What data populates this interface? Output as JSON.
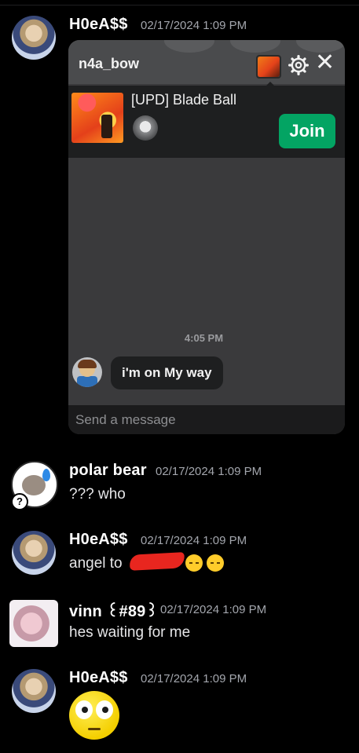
{
  "messages": [
    {
      "username": "H0eA$$",
      "timestamp": "02/17/2024 1:09 PM",
      "embed": {
        "chat_title": "n4a_bow",
        "game_title": "[UPD] Blade Ball",
        "join_label": "Join",
        "chat_time": "4:05 PM",
        "chat_message": "i'm on My way",
        "send_placeholder": "Send a message"
      }
    },
    {
      "username": "polar bear",
      "timestamp": "02/17/2024 1:09 PM",
      "text": "??? who",
      "badge": "?"
    },
    {
      "username": "H0eA$$",
      "timestamp": "02/17/2024 1:09 PM",
      "text": "angel to "
    },
    {
      "username": "vinn ꒰#89꒱",
      "timestamp": "02/17/2024 1:09 PM",
      "text": "hes waiting for me"
    },
    {
      "username": "H0eA$$",
      "timestamp": "02/17/2024 1:09 PM",
      "emoji": "flushed-face-emoji"
    }
  ],
  "icons": {
    "settings": "gear-icon",
    "close": "close-icon",
    "sleep_emoji": "sleepy-face-emoji"
  },
  "colors": {
    "background": "#000000",
    "join_button": "#03a463",
    "redaction": "#e8261f",
    "timestamp": "#a3a6ad"
  }
}
